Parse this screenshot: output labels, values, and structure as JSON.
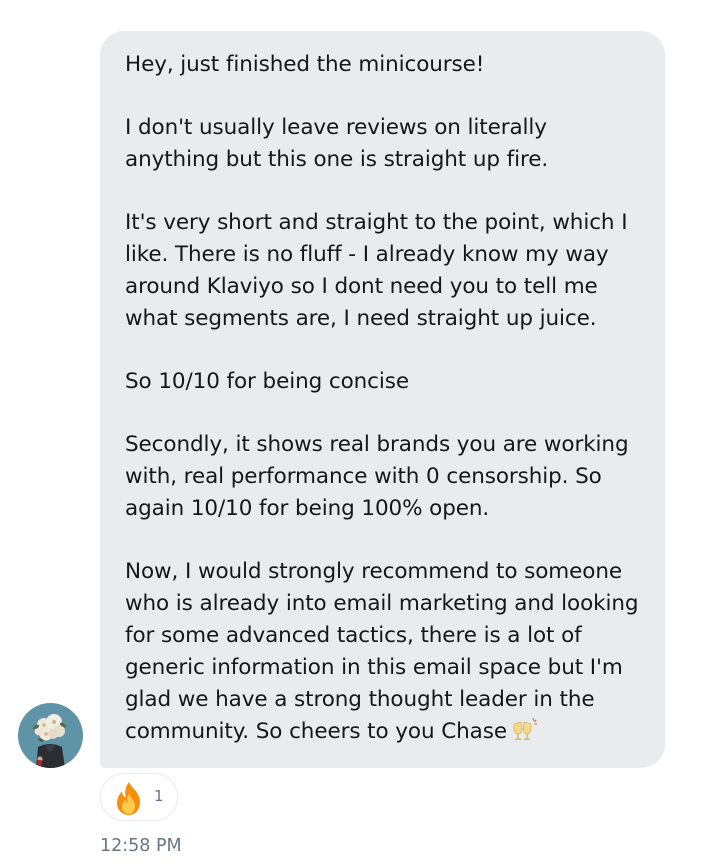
{
  "message": {
    "paragraphs": [
      "Hey, just finished the minicourse!",
      "I don't usually leave reviews on literally anything but this one is straight up fire.",
      "It's very short and straight to the point, which I like. There is no fluff - I already know my way around Klaviyo so I dont need you to tell me what segments are, I need straight up juice.",
      "So 10/10 for being concise",
      "Secondly, it shows real brands you are working with, real performance with 0 censorship. So again 10/10 for being 100% open.",
      "Now, I would strongly recommend to someone who is already into email marketing and looking for some advanced tactics, there is a lot of generic information in this email space but I'm glad we have a strong thought leader in the community. So cheers to you Chase"
    ],
    "trailing_emoji": "clinking-glasses-icon",
    "bubble_color": "#e9ecef",
    "text_color": "#14171a"
  },
  "reaction": {
    "emoji": "fire-icon",
    "count": "1"
  },
  "timestamp": "12:58 PM",
  "colors": {
    "muted": "#657786",
    "reaction_border": "#e6ecf0"
  }
}
